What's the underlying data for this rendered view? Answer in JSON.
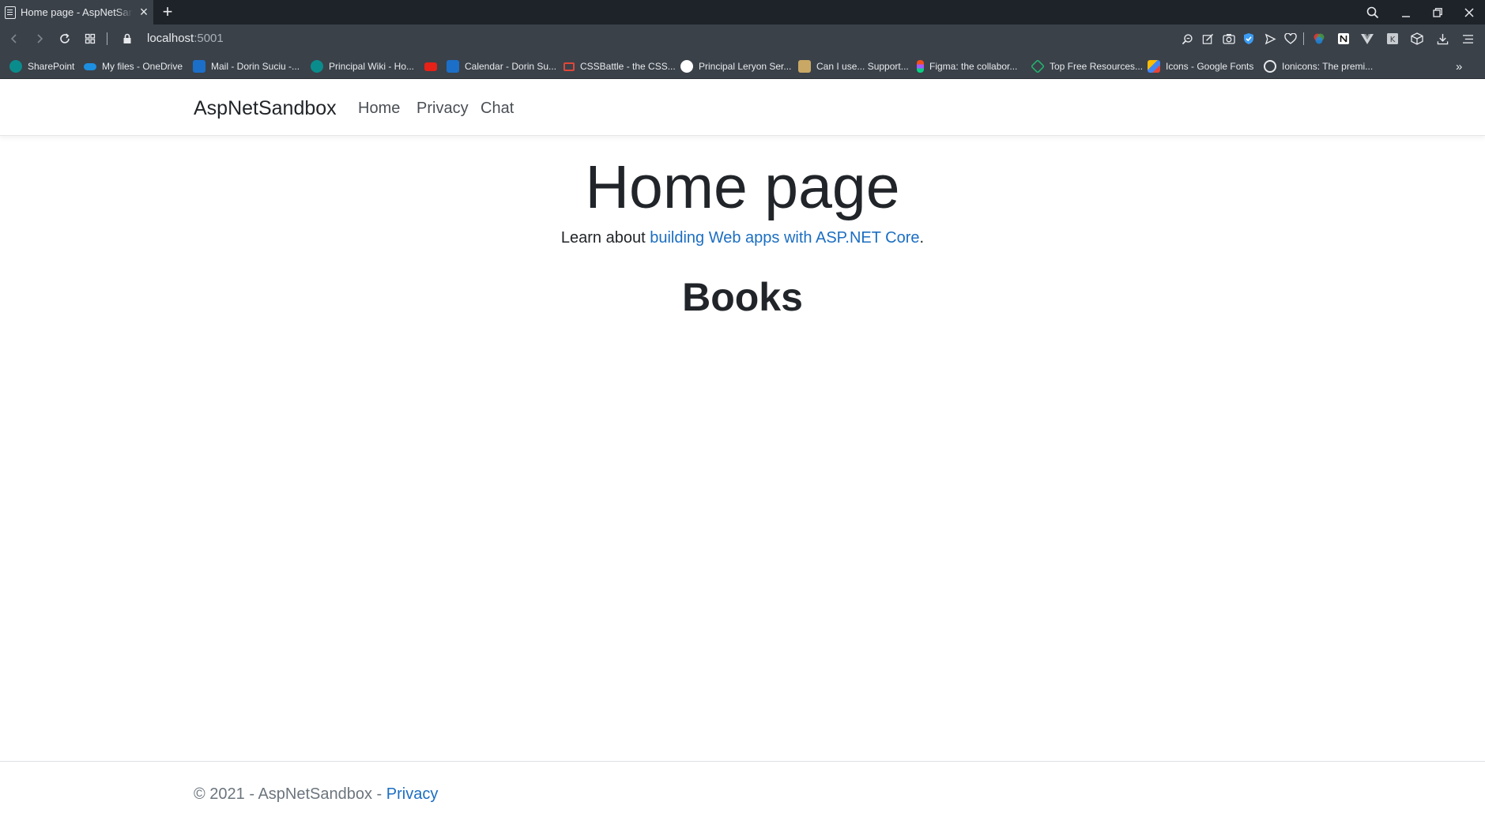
{
  "browser": {
    "tab": {
      "title": "Home page - AspNetSandbox",
      "close_glyph": "×",
      "favicon": "page-icon"
    },
    "new_tab_glyph": "+",
    "url": {
      "host": "localhost",
      "port": ":5001"
    },
    "bookmarks": [
      {
        "label": "SharePoint",
        "icon": "sharepoint-icon",
        "color": "#0b8c8c"
      },
      {
        "label": "My files - OneDrive",
        "icon": "onedrive-icon",
        "color": "#1d8fe1"
      },
      {
        "label": "Mail - Dorin Suciu -...",
        "icon": "outlook-icon",
        "color": "#1c6fc8"
      },
      {
        "label": "Principal Wiki - Ho...",
        "icon": "sharepoint-icon",
        "color": "#0b8c8c"
      },
      {
        "label": "",
        "icon": "youtube-icon",
        "color": "#e62117"
      },
      {
        "label": "Calendar - Dorin Su...",
        "icon": "calendar-icon",
        "color": "#1c6fc8"
      },
      {
        "label": "CSSBattle - the CSS...",
        "icon": "cssbattle-icon",
        "color": "#e0463a"
      },
      {
        "label": "Principal Leryon Ser...",
        "icon": "info-icon",
        "color": "#ffffff"
      },
      {
        "label": "Can I use... Support...",
        "icon": "caniuse-icon",
        "color": "#c9a865"
      },
      {
        "label": "Figma: the collabor...",
        "icon": "figma-icon",
        "color": "#f24e1e"
      },
      {
        "label": "Top Free Resources...",
        "icon": "resources-icon",
        "color": "#23b26d"
      },
      {
        "label": "Icons - Google Fonts",
        "icon": "google-fonts-icon",
        "color": "#4285f4"
      },
      {
        "label": "Ionicons: The premi...",
        "icon": "ionicons-icon",
        "color": "#3880ff"
      }
    ],
    "overflow_glyph": "»"
  },
  "site": {
    "brand": "AspNetSandbox",
    "nav": [
      "Home",
      "Privacy",
      "Chat"
    ],
    "title": "Home page",
    "learn_prefix": "Learn about ",
    "learn_link": "building Web apps with ASP.NET Core",
    "learn_suffix": ".",
    "books_heading": "Books",
    "footer_prefix": "© 2021 - AspNetSandbox - ",
    "footer_link": "Privacy"
  },
  "colors": {
    "chrome_dark": "#1e2329",
    "chrome": "#3a4149",
    "link": "#1b6ec2",
    "text": "#212529",
    "muted": "#6c757d"
  }
}
